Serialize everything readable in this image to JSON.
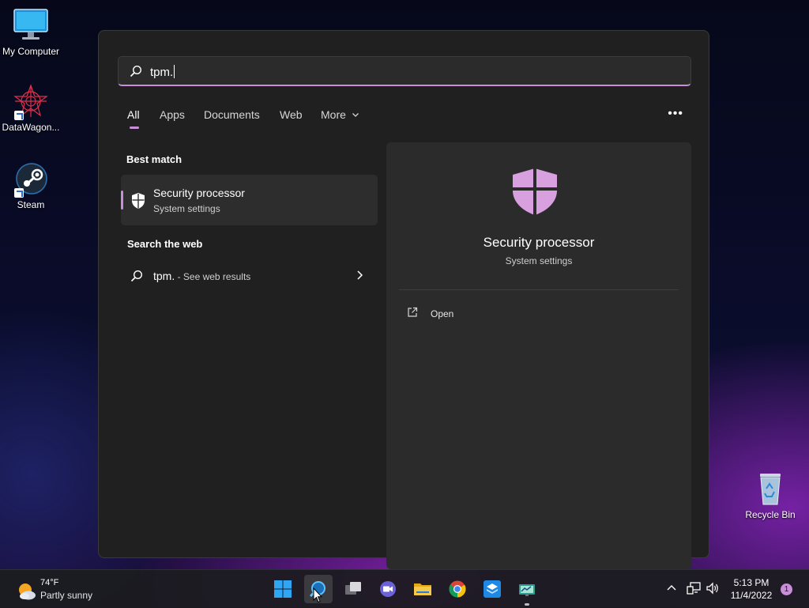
{
  "desktop": {
    "icons": [
      {
        "label": "My Computer"
      },
      {
        "label": "DataWagon..."
      },
      {
        "label": "Steam"
      },
      {
        "label": "Recycle Bin"
      }
    ]
  },
  "search": {
    "query": "tpm.",
    "tabs": [
      "All",
      "Apps",
      "Documents",
      "Web",
      "More"
    ],
    "active_tab": "All",
    "best_match_label": "Best match",
    "best_match": {
      "title": "Security processor",
      "subtitle": "System settings"
    },
    "web_label": "Search the web",
    "web_result": {
      "query": "tpm.",
      "suffix": " - See web results"
    },
    "detail": {
      "title": "Security processor",
      "subtitle": "System settings",
      "open_label": "Open"
    }
  },
  "taskbar": {
    "weather": {
      "temp": "74°F",
      "condition": "Partly sunny"
    },
    "clock": {
      "time": "5:13 PM",
      "date": "11/4/2022"
    },
    "notifications": "1"
  },
  "colors": {
    "accent": "#c88fd8",
    "panel": "#202020",
    "detail": "#2b2b2b"
  }
}
